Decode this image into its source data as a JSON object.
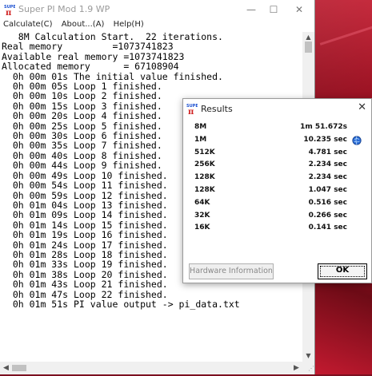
{
  "window": {
    "title": "Super PI Mod 1.9 WP",
    "minimize_glyph": "—",
    "maximize_glyph": "☐",
    "close_glyph": "✕"
  },
  "menu": {
    "items": [
      "Calculate(C)",
      "About...(A)",
      "Help(H)"
    ]
  },
  "console": {
    "lines": [
      "   8M Calculation Start.  22 iterations.",
      "Real memory         =1073741823",
      "Available real memory =1073741823",
      "Allocated memory      = 67108904",
      "  0h 00m 01s The initial value finished.",
      "  0h 00m 05s Loop 1 finished.",
      "  0h 00m 10s Loop 2 finished.",
      "  0h 00m 15s Loop 3 finished.",
      "  0h 00m 20s Loop 4 finished.",
      "  0h 00m 25s Loop 5 finished.",
      "  0h 00m 30s Loop 6 finished.",
      "  0h 00m 35s Loop 7 finished.",
      "  0h 00m 40s Loop 8 finished.",
      "  0h 00m 44s Loop 9 finished.",
      "  0h 00m 49s Loop 10 finished.",
      "  0h 00m 54s Loop 11 finished.",
      "  0h 00m 59s Loop 12 finished.",
      "  0h 01m 04s Loop 13 finished.",
      "  0h 01m 09s Loop 14 finished.",
      "  0h 01m 14s Loop 15 finished.",
      "  0h 01m 19s Loop 16 finished.",
      "  0h 01m 24s Loop 17 finished.",
      "  0h 01m 28s Loop 18 finished.",
      "  0h 01m 33s Loop 19 finished.",
      "  0h 01m 38s Loop 20 finished.",
      "  0h 01m 43s Loop 21 finished.",
      "  0h 01m 47s Loop 22 finished.",
      "  0h 01m 51s PI value output -> pi_data.txt"
    ]
  },
  "results": {
    "title": "Results",
    "close_glyph": "✕",
    "rows": [
      {
        "label": "8M",
        "value": "1m 51.672s"
      },
      {
        "label": "1M",
        "value": "10.235 sec"
      },
      {
        "label": "512K",
        "value": "4.781 sec"
      },
      {
        "label": "256K",
        "value": "2.234 sec"
      },
      {
        "label": "128K",
        "value": "2.234 sec"
      },
      {
        "label": "128K",
        "value": "1.047 sec"
      },
      {
        "label": "64K",
        "value": "0.516 sec"
      },
      {
        "label": "32K",
        "value": "0.266 sec"
      },
      {
        "label": "16K",
        "value": "0.141 sec"
      }
    ],
    "hardware_button": "Hardware Information",
    "ok_button": "OK"
  },
  "icons": {
    "app": "super-pi-icon",
    "verified": "verified-globe-icon"
  },
  "colors": {
    "desktop_red": "#c0182c",
    "icon_blue": "#1a4fd0",
    "icon_red": "#d02020"
  }
}
